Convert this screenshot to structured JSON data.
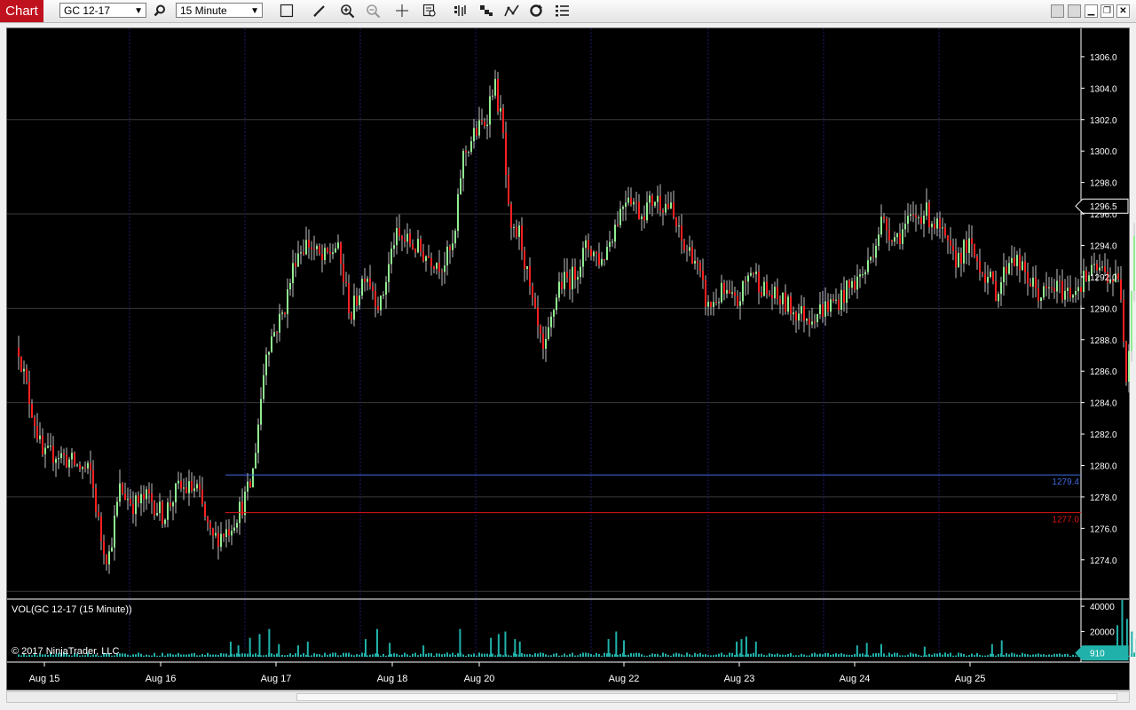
{
  "toolbar": {
    "tab_label": "Chart",
    "instrument": "GC 12-17",
    "interval": "15 Minute"
  },
  "colors": {
    "up_candle": "#90ee90",
    "down_candle": "#ff2020",
    "wick": "#c0c0c0",
    "volume": "#20b2aa",
    "blue_line": "#4169e1",
    "red_line": "#dc1414",
    "grid": "#3a3a3a",
    "vgrid": "#1a1a6a"
  },
  "chart_data": {
    "type": "candlestick",
    "instrument": "GC 12-17",
    "interval": "15 Minute",
    "x_ticks": [
      "Aug 15",
      "Aug 16",
      "Aug 17",
      "Aug 18",
      "Aug 20",
      "Aug 22",
      "Aug 23",
      "Aug 24",
      "Aug 25"
    ],
    "y_ticks": [
      "1306.0",
      "1304.0",
      "1302.0",
      "1300.0",
      "1298.0",
      "1296.0",
      "1294.0",
      "1292.0",
      "1290.0",
      "1288.0",
      "1286.0",
      "1284.0",
      "1282.0",
      "1280.0",
      "1278.0",
      "1276.0",
      "1274.0"
    ],
    "ylim": [
      1271.9,
      1307.8
    ],
    "price_path": [
      [
        0,
        1287.5
      ],
      [
        0.008,
        1285.0
      ],
      [
        0.016,
        1283.0
      ],
      [
        0.025,
        1280.5
      ],
      [
        0.04,
        1280.8
      ],
      [
        0.06,
        1280.0
      ],
      [
        0.075,
        1279.5
      ],
      [
        0.085,
        1275.5
      ],
      [
        0.093,
        1274.0
      ],
      [
        0.105,
        1278.5
      ],
      [
        0.12,
        1277.5
      ],
      [
        0.135,
        1278.0
      ],
      [
        0.15,
        1276.8
      ],
      [
        0.165,
        1278.5
      ],
      [
        0.185,
        1278.5
      ],
      [
        0.2,
        1275.2
      ],
      [
        0.218,
        1276.0
      ],
      [
        0.232,
        1277.5
      ],
      [
        0.242,
        1279.0
      ],
      [
        0.25,
        1283.5
      ],
      [
        0.257,
        1287.5
      ],
      [
        0.265,
        1288.5
      ],
      [
        0.275,
        1289.8
      ],
      [
        0.288,
        1293.5
      ],
      [
        0.3,
        1294.2
      ],
      [
        0.315,
        1293.0
      ],
      [
        0.33,
        1294.0
      ],
      [
        0.345,
        1289.5
      ],
      [
        0.36,
        1292.5
      ],
      [
        0.375,
        1290.0
      ],
      [
        0.39,
        1294.5
      ],
      [
        0.405,
        1294.2
      ],
      [
        0.42,
        1293.5
      ],
      [
        0.44,
        1292.8
      ],
      [
        0.452,
        1294.0
      ],
      [
        0.46,
        1299.5
      ],
      [
        0.472,
        1301.0
      ],
      [
        0.485,
        1302.0
      ],
      [
        0.493,
        1304.5
      ],
      [
        0.502,
        1301.5
      ],
      [
        0.51,
        1294.5
      ],
      [
        0.52,
        1294.8
      ],
      [
        0.532,
        1290.5
      ],
      [
        0.545,
        1286.8
      ],
      [
        0.56,
        1291.5
      ],
      [
        0.575,
        1292.0
      ],
      [
        0.59,
        1294.0
      ],
      [
        0.605,
        1293.0
      ],
      [
        0.62,
        1295.5
      ],
      [
        0.632,
        1297.5
      ],
      [
        0.645,
        1296.0
      ],
      [
        0.66,
        1297.0
      ],
      [
        0.675,
        1296.5
      ],
      [
        0.69,
        1293.8
      ],
      [
        0.7,
        1293.5
      ],
      [
        0.715,
        1290.0
      ],
      [
        0.73,
        1291.0
      ],
      [
        0.745,
        1290.2
      ],
      [
        0.76,
        1292.5
      ],
      [
        0.775,
        1291.0
      ],
      [
        0.79,
        1290.5
      ],
      [
        0.805,
        1289.8
      ],
      [
        0.82,
        1289.5
      ],
      [
        0.835,
        1290.0
      ],
      [
        0.85,
        1290.5
      ],
      [
        0.865,
        1291.5
      ],
      [
        0.88,
        1292.5
      ],
      [
        0.895,
        1295.5
      ],
      [
        0.91,
        1294.5
      ],
      [
        0.925,
        1295.5
      ],
      [
        0.94,
        1296.2
      ],
      [
        0.955,
        1295.0
      ],
      [
        0.97,
        1293.0
      ],
      [
        0.985,
        1294.0
      ],
      [
        1.0,
        1292.5
      ],
      [
        1.015,
        1291.0
      ],
      [
        1.03,
        1293.5
      ],
      [
        1.045,
        1292.0
      ],
      [
        1.06,
        1290.8
      ],
      [
        1.075,
        1291.3
      ],
      [
        1.09,
        1291.0
      ],
      [
        1.105,
        1291.8
      ],
      [
        1.12,
        1292.5
      ],
      [
        1.133,
        1292.0
      ],
      [
        1.143,
        1291.5
      ],
      [
        1.15,
        1285.2
      ],
      [
        1.158,
        1295.5
      ],
      [
        1.168,
        1297.8
      ],
      [
        1.18,
        1296.5
      ],
      [
        1.188,
        1296.3
      ]
    ],
    "horizontal_lines": [
      {
        "value": 1279.4,
        "label": "1279.4",
        "color": "#4169e1"
      },
      {
        "value": 1277.0,
        "label": "1277.0",
        "color": "#dc1414"
      }
    ],
    "last_price": 1296.5,
    "last_price_label": "1296.5",
    "volume_panel": {
      "label": "VOL(GC 12-17 (15 Minute))",
      "y_ticks": [
        "40000",
        "20000"
      ],
      "ylim": [
        0,
        45000
      ],
      "last_value": 910,
      "last_label": "910",
      "spikes": [
        [
          0.22,
          12000
        ],
        [
          0.228,
          9000
        ],
        [
          0.24,
          15000
        ],
        [
          0.25,
          18000
        ],
        [
          0.26,
          22000
        ],
        [
          0.27,
          10000
        ],
        [
          0.29,
          9000
        ],
        [
          0.3,
          12000
        ],
        [
          0.36,
          14000
        ],
        [
          0.372,
          22000
        ],
        [
          0.385,
          11000
        ],
        [
          0.42,
          9000
        ],
        [
          0.458,
          22000
        ],
        [
          0.49,
          15000
        ],
        [
          0.498,
          18000
        ],
        [
          0.505,
          20000
        ],
        [
          0.515,
          14000
        ],
        [
          0.52,
          12000
        ],
        [
          0.612,
          14000
        ],
        [
          0.62,
          20000
        ],
        [
          0.628,
          13000
        ],
        [
          0.745,
          12000
        ],
        [
          0.75,
          14000
        ],
        [
          0.755,
          16000
        ],
        [
          0.765,
          12000
        ],
        [
          0.87,
          9000
        ],
        [
          0.88,
          11000
        ],
        [
          0.895,
          10000
        ],
        [
          0.94,
          8000
        ],
        [
          1.01,
          10000
        ],
        [
          1.02,
          13000
        ],
        [
          1.14,
          25000
        ],
        [
          1.145,
          45000
        ],
        [
          1.15,
          30000
        ],
        [
          1.155,
          20000
        ],
        [
          1.16,
          14000
        ],
        [
          1.17,
          9000
        ]
      ]
    },
    "copyright": "© 2017 NinjaTrader, LLC"
  }
}
